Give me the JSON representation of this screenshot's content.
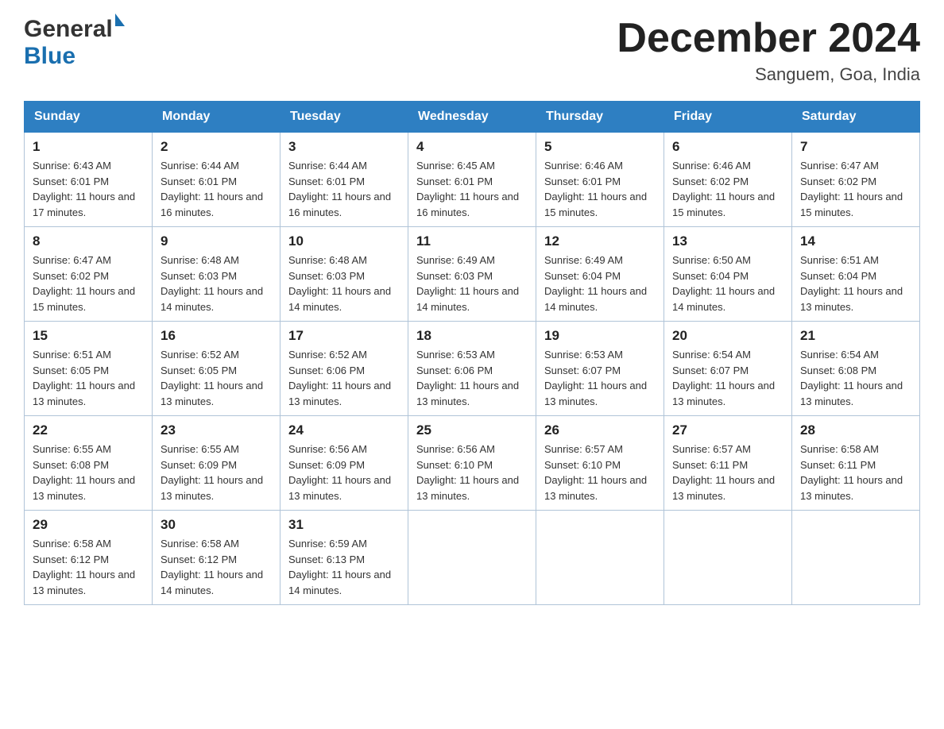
{
  "header": {
    "logo_general": "General",
    "logo_blue": "Blue",
    "title": "December 2024",
    "subtitle": "Sanguem, Goa, India"
  },
  "weekdays": [
    "Sunday",
    "Monday",
    "Tuesday",
    "Wednesday",
    "Thursday",
    "Friday",
    "Saturday"
  ],
  "weeks": [
    [
      {
        "day": "1",
        "sunrise": "Sunrise: 6:43 AM",
        "sunset": "Sunset: 6:01 PM",
        "daylight": "Daylight: 11 hours and 17 minutes."
      },
      {
        "day": "2",
        "sunrise": "Sunrise: 6:44 AM",
        "sunset": "Sunset: 6:01 PM",
        "daylight": "Daylight: 11 hours and 16 minutes."
      },
      {
        "day": "3",
        "sunrise": "Sunrise: 6:44 AM",
        "sunset": "Sunset: 6:01 PM",
        "daylight": "Daylight: 11 hours and 16 minutes."
      },
      {
        "day": "4",
        "sunrise": "Sunrise: 6:45 AM",
        "sunset": "Sunset: 6:01 PM",
        "daylight": "Daylight: 11 hours and 16 minutes."
      },
      {
        "day": "5",
        "sunrise": "Sunrise: 6:46 AM",
        "sunset": "Sunset: 6:01 PM",
        "daylight": "Daylight: 11 hours and 15 minutes."
      },
      {
        "day": "6",
        "sunrise": "Sunrise: 6:46 AM",
        "sunset": "Sunset: 6:02 PM",
        "daylight": "Daylight: 11 hours and 15 minutes."
      },
      {
        "day": "7",
        "sunrise": "Sunrise: 6:47 AM",
        "sunset": "Sunset: 6:02 PM",
        "daylight": "Daylight: 11 hours and 15 minutes."
      }
    ],
    [
      {
        "day": "8",
        "sunrise": "Sunrise: 6:47 AM",
        "sunset": "Sunset: 6:02 PM",
        "daylight": "Daylight: 11 hours and 15 minutes."
      },
      {
        "day": "9",
        "sunrise": "Sunrise: 6:48 AM",
        "sunset": "Sunset: 6:03 PM",
        "daylight": "Daylight: 11 hours and 14 minutes."
      },
      {
        "day": "10",
        "sunrise": "Sunrise: 6:48 AM",
        "sunset": "Sunset: 6:03 PM",
        "daylight": "Daylight: 11 hours and 14 minutes."
      },
      {
        "day": "11",
        "sunrise": "Sunrise: 6:49 AM",
        "sunset": "Sunset: 6:03 PM",
        "daylight": "Daylight: 11 hours and 14 minutes."
      },
      {
        "day": "12",
        "sunrise": "Sunrise: 6:49 AM",
        "sunset": "Sunset: 6:04 PM",
        "daylight": "Daylight: 11 hours and 14 minutes."
      },
      {
        "day": "13",
        "sunrise": "Sunrise: 6:50 AM",
        "sunset": "Sunset: 6:04 PM",
        "daylight": "Daylight: 11 hours and 14 minutes."
      },
      {
        "day": "14",
        "sunrise": "Sunrise: 6:51 AM",
        "sunset": "Sunset: 6:04 PM",
        "daylight": "Daylight: 11 hours and 13 minutes."
      }
    ],
    [
      {
        "day": "15",
        "sunrise": "Sunrise: 6:51 AM",
        "sunset": "Sunset: 6:05 PM",
        "daylight": "Daylight: 11 hours and 13 minutes."
      },
      {
        "day": "16",
        "sunrise": "Sunrise: 6:52 AM",
        "sunset": "Sunset: 6:05 PM",
        "daylight": "Daylight: 11 hours and 13 minutes."
      },
      {
        "day": "17",
        "sunrise": "Sunrise: 6:52 AM",
        "sunset": "Sunset: 6:06 PM",
        "daylight": "Daylight: 11 hours and 13 minutes."
      },
      {
        "day": "18",
        "sunrise": "Sunrise: 6:53 AM",
        "sunset": "Sunset: 6:06 PM",
        "daylight": "Daylight: 11 hours and 13 minutes."
      },
      {
        "day": "19",
        "sunrise": "Sunrise: 6:53 AM",
        "sunset": "Sunset: 6:07 PM",
        "daylight": "Daylight: 11 hours and 13 minutes."
      },
      {
        "day": "20",
        "sunrise": "Sunrise: 6:54 AM",
        "sunset": "Sunset: 6:07 PM",
        "daylight": "Daylight: 11 hours and 13 minutes."
      },
      {
        "day": "21",
        "sunrise": "Sunrise: 6:54 AM",
        "sunset": "Sunset: 6:08 PM",
        "daylight": "Daylight: 11 hours and 13 minutes."
      }
    ],
    [
      {
        "day": "22",
        "sunrise": "Sunrise: 6:55 AM",
        "sunset": "Sunset: 6:08 PM",
        "daylight": "Daylight: 11 hours and 13 minutes."
      },
      {
        "day": "23",
        "sunrise": "Sunrise: 6:55 AM",
        "sunset": "Sunset: 6:09 PM",
        "daylight": "Daylight: 11 hours and 13 minutes."
      },
      {
        "day": "24",
        "sunrise": "Sunrise: 6:56 AM",
        "sunset": "Sunset: 6:09 PM",
        "daylight": "Daylight: 11 hours and 13 minutes."
      },
      {
        "day": "25",
        "sunrise": "Sunrise: 6:56 AM",
        "sunset": "Sunset: 6:10 PM",
        "daylight": "Daylight: 11 hours and 13 minutes."
      },
      {
        "day": "26",
        "sunrise": "Sunrise: 6:57 AM",
        "sunset": "Sunset: 6:10 PM",
        "daylight": "Daylight: 11 hours and 13 minutes."
      },
      {
        "day": "27",
        "sunrise": "Sunrise: 6:57 AM",
        "sunset": "Sunset: 6:11 PM",
        "daylight": "Daylight: 11 hours and 13 minutes."
      },
      {
        "day": "28",
        "sunrise": "Sunrise: 6:58 AM",
        "sunset": "Sunset: 6:11 PM",
        "daylight": "Daylight: 11 hours and 13 minutes."
      }
    ],
    [
      {
        "day": "29",
        "sunrise": "Sunrise: 6:58 AM",
        "sunset": "Sunset: 6:12 PM",
        "daylight": "Daylight: 11 hours and 13 minutes."
      },
      {
        "day": "30",
        "sunrise": "Sunrise: 6:58 AM",
        "sunset": "Sunset: 6:12 PM",
        "daylight": "Daylight: 11 hours and 14 minutes."
      },
      {
        "day": "31",
        "sunrise": "Sunrise: 6:59 AM",
        "sunset": "Sunset: 6:13 PM",
        "daylight": "Daylight: 11 hours and 14 minutes."
      },
      null,
      null,
      null,
      null
    ]
  ]
}
